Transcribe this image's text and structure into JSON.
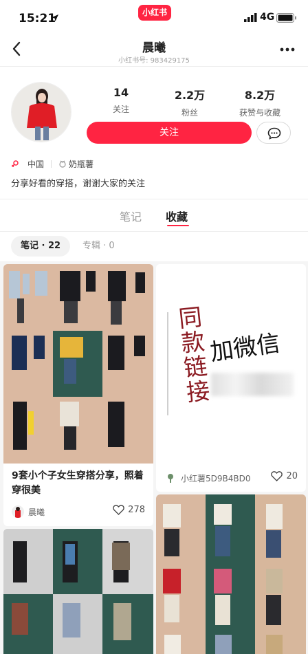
{
  "status_bar": {
    "time": "15:21",
    "network": "4G",
    "app_badge": "小红书"
  },
  "nav": {
    "title": "晨曦",
    "subtitle": "小红书号: 983429175"
  },
  "profile": {
    "stats": [
      {
        "value": "14",
        "label": "关注"
      },
      {
        "value": "2.2万",
        "label": "粉丝"
      },
      {
        "value": "8.2万",
        "label": "获赞与收藏"
      }
    ],
    "follow_label": "关注",
    "location": "中国",
    "tag": "奶瓶薯",
    "bio": "分享好看的穿搭，谢谢大家的关注"
  },
  "tabs": [
    {
      "label": "笔记"
    },
    {
      "label": "收藏"
    }
  ],
  "filters": [
    {
      "label": "笔记 · 22"
    },
    {
      "label": "专辑 · 0"
    }
  ],
  "cards": [
    {
      "title": "9套小个子女生穿搭分享，照着穿很美",
      "author": "晨曦",
      "likes": "278"
    },
    {
      "image_text_1": "同款链接",
      "image_text_2": "加微信",
      "author": "小红薯5D9B4BD0",
      "likes": "20"
    },
    {
      "title": "",
      "author": "",
      "likes": ""
    },
    {
      "title": "",
      "author": "",
      "likes": ""
    }
  ],
  "colors": {
    "accent": "#ff2442",
    "card_bg_beige": "#d9b8a0",
    "card_bg_green": "#2f5a50"
  }
}
